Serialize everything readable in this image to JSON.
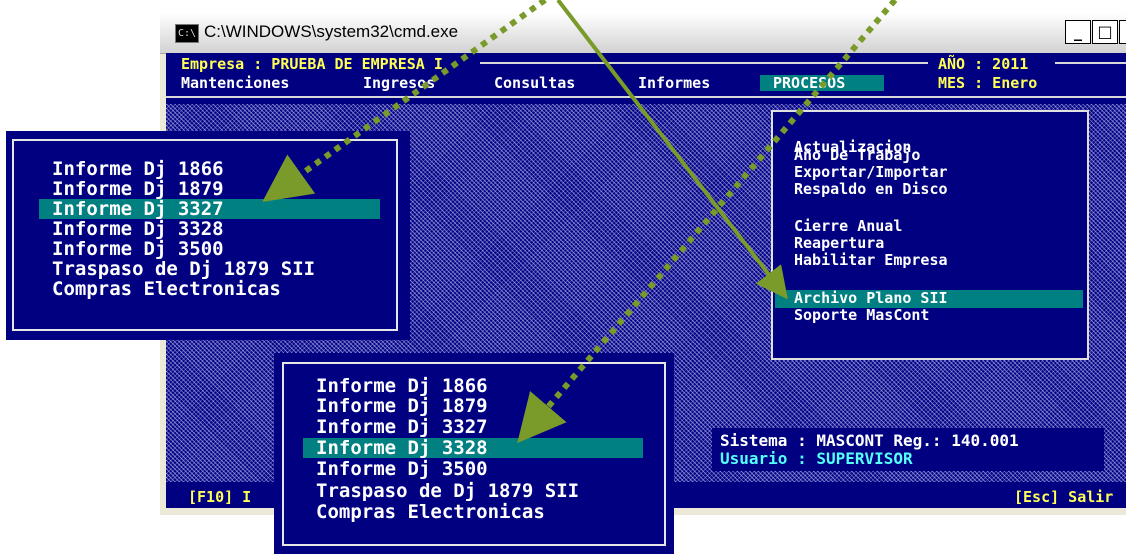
{
  "window": {
    "title": "C:\\WINDOWS\\system32\\cmd.exe",
    "icon_text": "C:\\",
    "buttons": {
      "minimize": "_",
      "maximize": "□",
      "close": "×"
    }
  },
  "header": {
    "empresa_label": "Empresa : PRUEBA DE EMPRESA I",
    "ano": "AÑO : 2011",
    "mes": "MES : Enero"
  },
  "menubar": {
    "items": [
      "Mantenciones",
      "Ingresos",
      "Consultas",
      "Informes",
      "PROCESOS"
    ]
  },
  "procesos_menu": {
    "items": [
      "Actualizacion",
      "Año De Trabajo",
      "Exportar/Importar",
      "Respaldo en Disco",
      "Cierre Anual",
      "Reapertura",
      "Habilitar Empresa",
      "Archivo Plano SII",
      "Soporte MasCont"
    ],
    "selected": "Archivo Plano SII"
  },
  "status": {
    "sistema": "Sistema : MASCONT Reg.: 140.001",
    "usuario": "Usuario : SUPERVISOR"
  },
  "bottom_bar": {
    "left": "[F10] I",
    "right": "[Esc] Salir"
  },
  "popup_left": {
    "items": [
      "Informe Dj 1866",
      "Informe Dj 1879",
      "Informe Dj 3327",
      "Informe Dj 3328",
      "Informe Dj 3500",
      "Traspaso de Dj 1879 SII",
      "Compras Electronicas"
    ],
    "selected": "Informe Dj 3327"
  },
  "popup_bottom": {
    "items": [
      "Informe Dj 1866",
      "Informe Dj 1879",
      "Informe Dj 3327",
      "Informe Dj 3328",
      "Informe Dj 3500",
      "Traspaso de Dj 1879 SII",
      "Compras Electronicas"
    ],
    "selected": "Informe Dj 3328"
  },
  "colors": {
    "console_bg": "#000080",
    "highlight": "#008080",
    "header_text": "#ffff55",
    "arrow": "#7a9a2a"
  }
}
